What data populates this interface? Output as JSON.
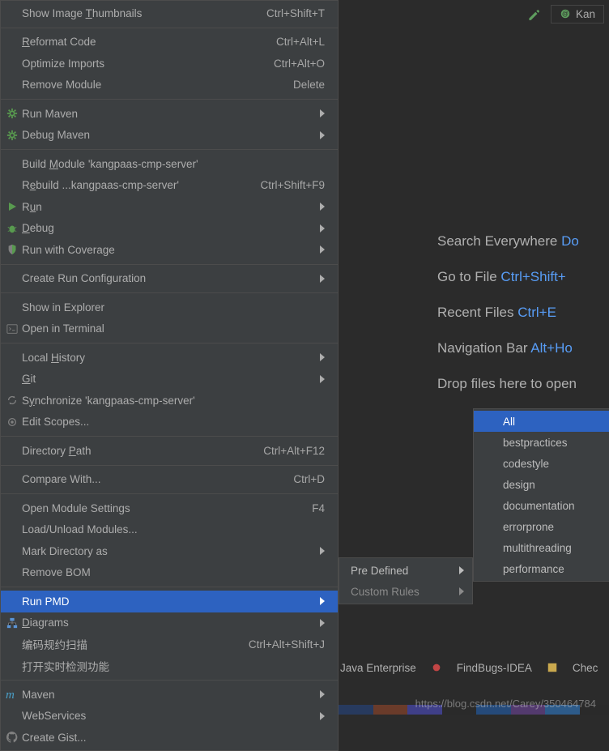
{
  "toolbar": {
    "config_label": "Kan"
  },
  "watermark": "https://blog.csdn.net/Carey/350464784",
  "menu1": [
    {
      "icon": "",
      "label": "Show Image Thumbnails",
      "u": "T",
      "shortcut": "Ctrl+Shift+T",
      "arrow": false
    },
    {
      "sep": true
    },
    {
      "icon": "",
      "label": "Reformat Code",
      "u": "R",
      "shortcut": "Ctrl+Alt+L",
      "arrow": false
    },
    {
      "icon": "",
      "label": "Optimize Imports",
      "u": "",
      "shortcut": "Ctrl+Alt+O",
      "arrow": false
    },
    {
      "icon": "",
      "label": "Remove Module",
      "u": "",
      "shortcut": "Delete",
      "arrow": false
    },
    {
      "sep": true
    },
    {
      "icon": "gear-green",
      "label": "Run Maven",
      "u": "",
      "shortcut": "",
      "arrow": true
    },
    {
      "icon": "gear-green",
      "label": "Debug Maven",
      "u": "",
      "shortcut": "",
      "arrow": true
    },
    {
      "sep": true
    },
    {
      "icon": "",
      "label": "Build Module 'kangpaas-cmp-server'",
      "u": "M",
      "shortcut": "",
      "arrow": false
    },
    {
      "icon": "",
      "label": "Rebuild ...kangpaas-cmp-server'",
      "u": "e",
      "shortcut": "Ctrl+Shift+F9",
      "arrow": false
    },
    {
      "icon": "play-green",
      "label": "Run",
      "u": "u",
      "shortcut": "",
      "arrow": true
    },
    {
      "icon": "bug-green",
      "label": "Debug",
      "u": "D",
      "shortcut": "",
      "arrow": true
    },
    {
      "icon": "shield",
      "label": "Run with Coverage",
      "u": "",
      "shortcut": "",
      "arrow": true
    },
    {
      "sep": true
    },
    {
      "icon": "",
      "label": "Create Run Configuration",
      "u": "",
      "shortcut": "",
      "arrow": true
    },
    {
      "sep": true
    },
    {
      "icon": "",
      "label": "Show in Explorer",
      "u": "",
      "shortcut": "",
      "arrow": false
    },
    {
      "icon": "terminal",
      "label": "Open in Terminal",
      "u": "",
      "shortcut": "",
      "arrow": false
    },
    {
      "sep": true
    },
    {
      "icon": "",
      "label": "Local History",
      "u": "H",
      "shortcut": "",
      "arrow": true
    },
    {
      "icon": "",
      "label": "Git",
      "u": "G",
      "shortcut": "",
      "arrow": true
    },
    {
      "icon": "sync",
      "label": "Synchronize 'kangpaas-cmp-server'",
      "u": "y",
      "shortcut": "",
      "arrow": false
    },
    {
      "icon": "circle",
      "label": "Edit Scopes...",
      "u": "",
      "shortcut": "",
      "arrow": false
    },
    {
      "sep": true
    },
    {
      "icon": "",
      "label": "Directory Path",
      "u": "P",
      "shortcut": "Ctrl+Alt+F12",
      "arrow": false
    },
    {
      "sep": true
    },
    {
      "icon": "",
      "label": "Compare With...",
      "u": "",
      "shortcut": "Ctrl+D",
      "arrow": false
    },
    {
      "sep": true
    },
    {
      "icon": "",
      "label": "Open Module Settings",
      "u": "",
      "shortcut": "F4",
      "arrow": false
    },
    {
      "icon": "",
      "label": "Load/Unload Modules...",
      "u": "",
      "shortcut": "",
      "arrow": false
    },
    {
      "icon": "",
      "label": "Mark Directory as",
      "u": "",
      "shortcut": "",
      "arrow": true
    },
    {
      "icon": "",
      "label": "Remove BOM",
      "u": "",
      "shortcut": "",
      "arrow": false
    },
    {
      "sep": true
    },
    {
      "icon": "",
      "label": "Run PMD",
      "u": "",
      "shortcut": "",
      "arrow": true,
      "selected": true
    },
    {
      "icon": "diagram",
      "label": "Diagrams",
      "u": "D",
      "shortcut": "",
      "arrow": true
    },
    {
      "icon": "",
      "label": "编码规约扫描",
      "u": "",
      "shortcut": "Ctrl+Alt+Shift+J",
      "arrow": false
    },
    {
      "icon": "",
      "label": "打开实时检测功能",
      "u": "",
      "shortcut": "",
      "arrow": false
    },
    {
      "sep": true
    },
    {
      "icon": "m",
      "label": "Maven",
      "u": "",
      "shortcut": "",
      "arrow": true
    },
    {
      "icon": "",
      "label": "WebServices",
      "u": "",
      "shortcut": "",
      "arrow": true
    },
    {
      "icon": "github",
      "label": "Create Gist...",
      "u": "",
      "shortcut": "",
      "arrow": false
    }
  ],
  "menu2": [
    {
      "label": "Pre Defined",
      "arrow": true,
      "first": true
    },
    {
      "label": "Custom Rules",
      "arrow": true
    }
  ],
  "menu3": [
    {
      "label": "All",
      "selected": true
    },
    {
      "label": "bestpractices"
    },
    {
      "label": "codestyle"
    },
    {
      "label": "design"
    },
    {
      "label": "documentation"
    },
    {
      "label": "errorprone"
    },
    {
      "label": "multithreading"
    },
    {
      "label": "performance"
    }
  ],
  "welcome": [
    {
      "text": "Search Everywhere",
      "key": "Do"
    },
    {
      "text": "Go to File",
      "key": "Ctrl+Shift+"
    },
    {
      "text": "Recent Files",
      "key": "Ctrl+E"
    },
    {
      "text": "Navigation Bar",
      "key": "Alt+Ho"
    },
    {
      "text": "Drop files here to open",
      "key": ""
    }
  ],
  "status": {
    "java_ee": "Java Enterprise",
    "findbugs": "FindBugs-IDEA",
    "checkstyle": "Chec"
  }
}
